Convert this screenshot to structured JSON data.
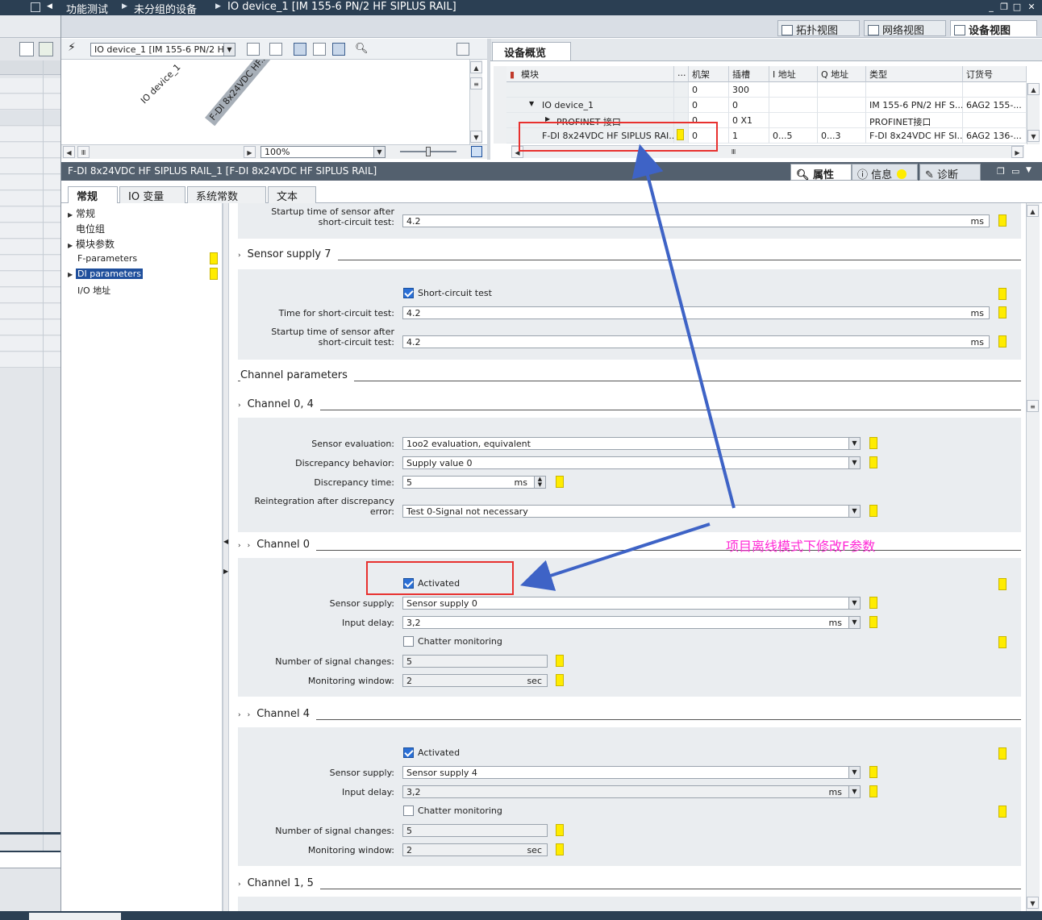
{
  "title_bar": {
    "crumbs": [
      "功能测试",
      "未分组的设备",
      "IO device_1 [IM 155-6 PN/2 HF SIPLUS RAIL]"
    ]
  },
  "view_tabs": [
    "拓扑视图",
    "网络视图",
    "设备视图"
  ],
  "canvas": {
    "device_select": "IO device_1 [IM 155-6 PN/2 HF",
    "label_device": "IO device_1",
    "label_module": "F-DI 8x24VDC HF...",
    "zoom": "100%"
  },
  "overview": {
    "tab": "设备概览",
    "columns": [
      "模块",
      "...",
      "机架",
      "插槽",
      "I 地址",
      "Q 地址",
      "类型",
      "订货号"
    ],
    "rows": [
      {
        "module": "",
        "rack": "0",
        "slot": "300",
        "i": "",
        "q": "",
        "type": "",
        "order": ""
      },
      {
        "module": "IO device_1",
        "rack": "0",
        "slot": "0",
        "i": "",
        "q": "",
        "type": "IM 155-6 PN/2 HF S...",
        "order": "6AG2 155-..."
      },
      {
        "module": "PROFINET 接口",
        "rack": "0",
        "slot": "0 X1",
        "i": "",
        "q": "",
        "type": "PROFINET接口",
        "order": ""
      },
      {
        "module": "F-DI 8x24VDC HF SIPLUS RAI...",
        "rack": "0",
        "slot": "1",
        "i": "0...5",
        "q": "0...3",
        "type": "F-DI 8x24VDC HF SI...",
        "order": "6AG2 136-..."
      }
    ]
  },
  "properties": {
    "title": "F-DI 8x24VDC HF SIPLUS RAIL_1 [F-DI 8x24VDC HF SIPLUS RAIL]",
    "tabs": [
      "属性",
      "信息",
      "诊断"
    ],
    "subtabs": [
      "常规",
      "IO 变量",
      "系统常数",
      "文本"
    ]
  },
  "nav": [
    "常规",
    "电位组",
    "模块参数",
    "F-parameters",
    "DI parameters",
    "I/O 地址"
  ],
  "params": {
    "startup_label": "Startup time of sensor after short-circuit test:",
    "startup_label_1": "Startup time of sensor after",
    "startup_label_2": "short-circuit test:",
    "startup_value_top": "4.2",
    "unit_ms": "ms",
    "unit_sec": "sec",
    "sensor_supply_7": "Sensor supply 7",
    "short_circuit_test": "Short-circuit test",
    "time_sc_label": "Time for short-circuit test:",
    "time_sc_value": "4.2",
    "startup_value_7": "4.2",
    "channel_params": "Channel parameters",
    "channel_04": "Channel 0, 4",
    "sensor_eval_label": "Sensor evaluation:",
    "sensor_eval_value": "1oo2 evaluation, equivalent",
    "disc_behavior_label": "Discrepancy behavior:",
    "disc_behavior_value": "Supply value 0",
    "disc_time_label": "Discrepancy time:",
    "disc_time_value": "5",
    "reint_label_1": "Reintegration after discrepancy",
    "reint_label_2": "error:",
    "reint_value": "Test 0-Signal not necessary",
    "channel_0": "Channel 0",
    "activated": "Activated",
    "sensor_supply_label": "Sensor supply:",
    "ch0_supply": "Sensor supply 0",
    "input_delay_label": "Input delay:",
    "ch0_delay": "3,2",
    "chatter": "Chatter monitoring",
    "num_changes_label": "Number of signal changes:",
    "ch0_changes": "5",
    "mon_window_label": "Monitoring window:",
    "ch0_window": "2",
    "channel_4": "Channel 4",
    "ch4_supply": "Sensor supply 4",
    "ch4_delay": "3,2",
    "ch4_changes": "5",
    "ch4_window": "2",
    "channel_15": "Channel 1, 5"
  },
  "annotation": "项目离线模式下修改F参数",
  "colors": {
    "accent_annotation": "#ff2bd6",
    "highlight_box": "#e8312f",
    "arrow": "#3e63c6",
    "title_bg": "#2b3f53"
  }
}
